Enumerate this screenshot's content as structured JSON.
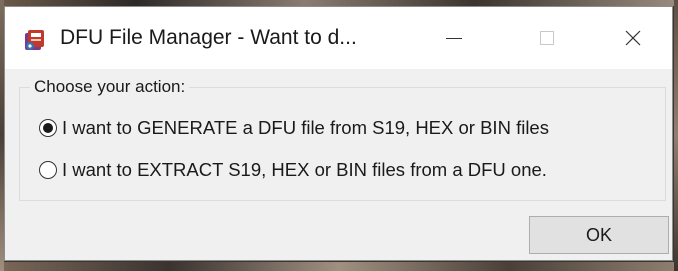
{
  "window": {
    "title": "DFU File Manager - Want to d...",
    "icon": "dfu-app-icon",
    "controls": {
      "minimize_icon": "minimize-icon",
      "maximize_icon": "maximize-icon",
      "close_icon": "close-icon",
      "maximize_enabled": false
    }
  },
  "group": {
    "label": "Choose your action:"
  },
  "options": [
    {
      "label": "I want to GENERATE a DFU file from S19, HEX or BIN files",
      "selected": true
    },
    {
      "label": "I want to EXTRACT S19, HEX or BIN files from a DFU one.",
      "selected": false
    }
  ],
  "buttons": {
    "ok_label": "OK"
  }
}
